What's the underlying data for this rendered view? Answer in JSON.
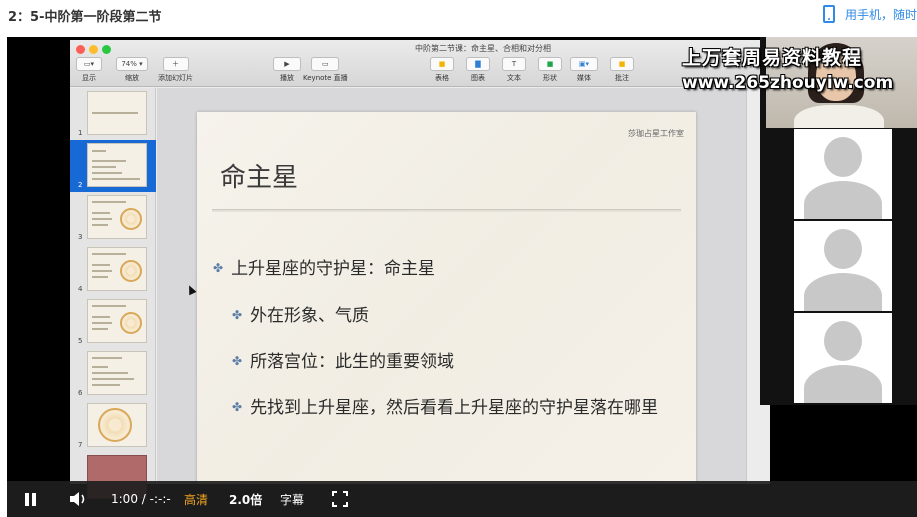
{
  "header": {
    "lesson_title": "2：5-中阶第一阶段第二节",
    "phone_link": "用手机，随时"
  },
  "keynote": {
    "document_title": "中阶第二节课：命主星、合相和对分相",
    "toolbar": [
      {
        "button": "▭▾",
        "label": "显示"
      },
      {
        "button": "74% ▾",
        "label": "缩放"
      },
      {
        "button": "＋",
        "label": "添加幻灯片"
      },
      {
        "button": "▶",
        "label": "播放"
      },
      {
        "button": "▭",
        "label": "Keynote 直播"
      },
      {
        "button": "■",
        "label": "表格"
      },
      {
        "button": "▇",
        "label": "图表"
      },
      {
        "button": "T",
        "label": "文本"
      },
      {
        "button": "■",
        "label": "形状"
      },
      {
        "button": "▣▾",
        "label": "媒体"
      },
      {
        "button": "■",
        "label": "批注"
      }
    ],
    "slide_numbers": [
      "1",
      "2",
      "3",
      "4",
      "5",
      "6",
      "7"
    ],
    "selected_slide": 2,
    "slide": {
      "studio": "莎珈占星工作室",
      "title": "命主星",
      "bullets": [
        "上升星座的守护星：命主星",
        "外在形象、气质",
        "所落宫位：此生的重要领域",
        "先找到上升星座，然后看看上升星座的守护星落在哪里"
      ]
    }
  },
  "watermark": {
    "line1": "上万套周易资料教程",
    "line2": "www.265zhouyiw.com"
  },
  "controls": {
    "time": "1:00 / -:-:-",
    "quality": "高清",
    "speed": "2.0倍",
    "subtitle": "字幕"
  },
  "colors": {
    "accent_blue": "#2f8be7",
    "selected_thumb": "#1769d6",
    "quality_orange": "#f5a623",
    "bullet_mark": "#5b7fa6"
  }
}
